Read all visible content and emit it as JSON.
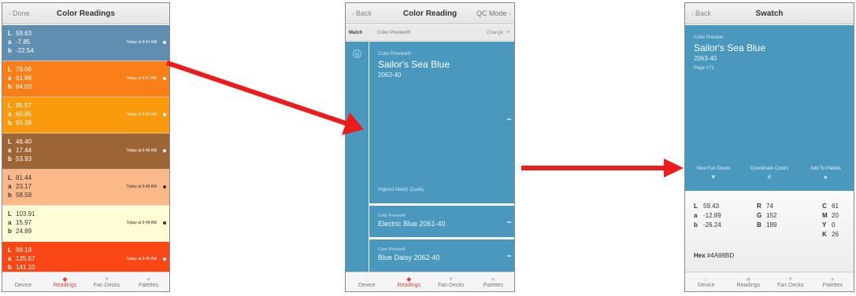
{
  "colors": {
    "accent": "#e0413c",
    "swatch": "#4a98bd",
    "arrow": "#ec1c1c"
  },
  "screen1": {
    "nav_left": "Done",
    "title": "Color Readings",
    "readings": [
      {
        "l": "59.63",
        "a": "-7.85",
        "b": "-22.54",
        "time": "Today at 9:41 AM",
        "bg": "#5f8eb1",
        "fg": "#ffffff"
      },
      {
        "l": "79.06",
        "a": "61.88",
        "b": "84.03",
        "time": "Today at 9:41 AM",
        "bg": "#fa7f19",
        "fg": "#ffffff"
      },
      {
        "l": "95.57",
        "a": "60.85",
        "b": "95.38",
        "time": "Today at 9:42 AM",
        "bg": "#fb9a0c",
        "fg": "#ffffff"
      },
      {
        "l": "46.40",
        "a": "17.44",
        "b": "53.93",
        "time": "Today at 9:48 AM",
        "bg": "#9d6535",
        "fg": "#ffffff"
      },
      {
        "l": "81.44",
        "a": "23.17",
        "b": "58.58",
        "time": "Today at 9:48 AM",
        "bg": "#fbb98a",
        "fg": "#333333"
      },
      {
        "l": "103.91",
        "a": "15.97",
        "b": "24.89",
        "time": "Today at 9:48 AM",
        "bg": "#fefdd6",
        "fg": "#333333"
      },
      {
        "l": "99.19",
        "a": "125.67",
        "b": "141.10",
        "time": "Today at 9:48 AM",
        "bg": "#fb4716",
        "fg": "#ffffff"
      }
    ],
    "tabs": [
      {
        "label": "Device",
        "icon": "☼"
      },
      {
        "label": "Readings",
        "icon": "◆"
      },
      {
        "label": "Fan Decks",
        "icon": "▼"
      },
      {
        "label": "Palettes",
        "icon": "●"
      }
    ]
  },
  "screen2": {
    "nav_left": "Back",
    "title": "Color Reading",
    "nav_right": "QC Mode",
    "match_label": "Match",
    "match_source": "Color Preview®",
    "change_label": "Change",
    "main": {
      "collection": "Color Preview®",
      "name": "Sailor's Sea Blue",
      "code": "2063-40",
      "quality": "Highest Match Quality"
    },
    "alternatives": [
      {
        "collection": "Color Preview®",
        "name": "Electric Blue 2061-40"
      },
      {
        "collection": "Color Preview®",
        "name": "Blue Daisy 2062-40"
      }
    ],
    "tabs": [
      {
        "label": "Device",
        "icon": "☼"
      },
      {
        "label": "Readings",
        "icon": "◆"
      },
      {
        "label": "Fan Decks",
        "icon": "▼"
      },
      {
        "label": "Palettes",
        "icon": "●"
      }
    ]
  },
  "screen3": {
    "nav_left": "Back",
    "title": "Swatch",
    "collection": "Color Preview",
    "name": "Sailor's Sea Blue",
    "code": "2063-40",
    "page": "Page #71",
    "actions": [
      {
        "label": "View Fan Decks",
        "icon": "▼"
      },
      {
        "label": "Coordinate Colors",
        "icon": "#"
      },
      {
        "label": "Add To Palette",
        "icon": "●"
      }
    ],
    "lab": [
      {
        "k": "L",
        "v": "59.43"
      },
      {
        "k": "a",
        "v": "-12.89"
      },
      {
        "k": "b",
        "v": "-26.24"
      }
    ],
    "rgb": [
      {
        "k": "R",
        "v": "74"
      },
      {
        "k": "G",
        "v": "152"
      },
      {
        "k": "B",
        "v": "189"
      }
    ],
    "cmyk": [
      {
        "k": "C",
        "v": "61"
      },
      {
        "k": "M",
        "v": "20"
      },
      {
        "k": "Y",
        "v": "0"
      },
      {
        "k": "K",
        "v": "26"
      }
    ],
    "hex_label": "Hex",
    "hex_value": "#4A98BD",
    "tabs": [
      {
        "label": "Device",
        "icon": "☼"
      },
      {
        "label": "Readings",
        "icon": "◆"
      },
      {
        "label": "Fan Decks",
        "icon": "▼"
      },
      {
        "label": "Palettes",
        "icon": "●"
      }
    ]
  }
}
